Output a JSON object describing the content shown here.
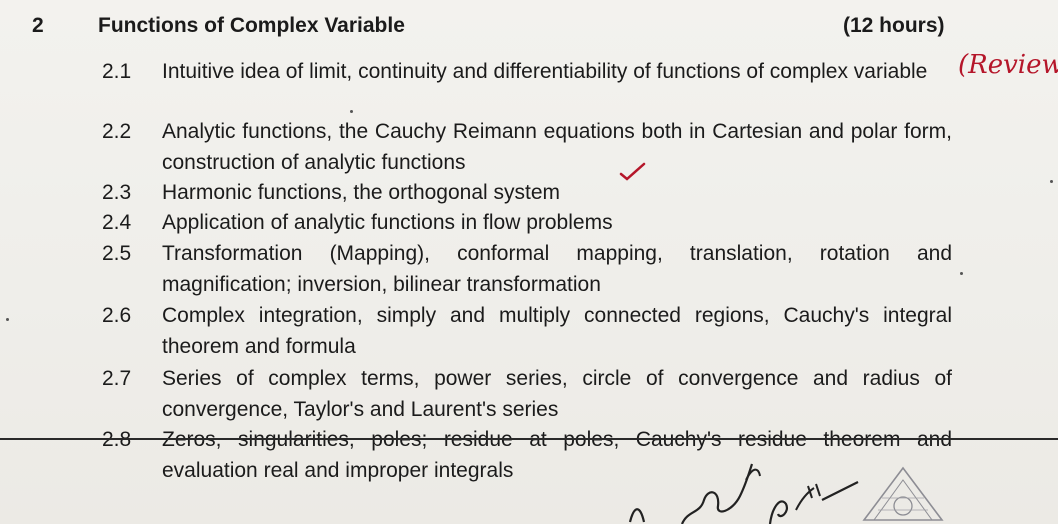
{
  "unit": {
    "number": "2",
    "title": "Functions of Complex Variable",
    "hours": "(12 hours)"
  },
  "topics": [
    {
      "num": "2.1",
      "text": "Intuitive idea of limit, continuity and differentiability of functions of complex variable"
    },
    {
      "num": "2.2",
      "text": "Analytic functions, the Cauchy Reimann equations both in Cartesian and polar form, construction of analytic functions"
    },
    {
      "num": "2.3",
      "text": "Harmonic functions, the orthogonal system"
    },
    {
      "num": "2.4",
      "text": "Application of analytic functions in flow problems"
    },
    {
      "num": "2.5",
      "text": "Transformation (Mapping), conformal mapping, translation, rotation and magnification; inversion, bilinear transformation"
    },
    {
      "num": "2.6",
      "text": "Complex integration, simply and multiply connected regions, Cauchy's integral theorem and formula"
    },
    {
      "num": "2.7",
      "text": "Series of complex terms, power series, circle of convergence and radius of convergence, Taylor's and Laurent's series"
    },
    {
      "num": "2.8",
      "text": "Zeros, singularities, poles; residue at poles, Cauchy's residue theorem and evaluation real and improper integrals"
    }
  ],
  "handwritten_note": "(Review",
  "colors": {
    "ink": "#1b1b1b",
    "annotation": "#b5162a",
    "paper": "#f1f0ec"
  }
}
